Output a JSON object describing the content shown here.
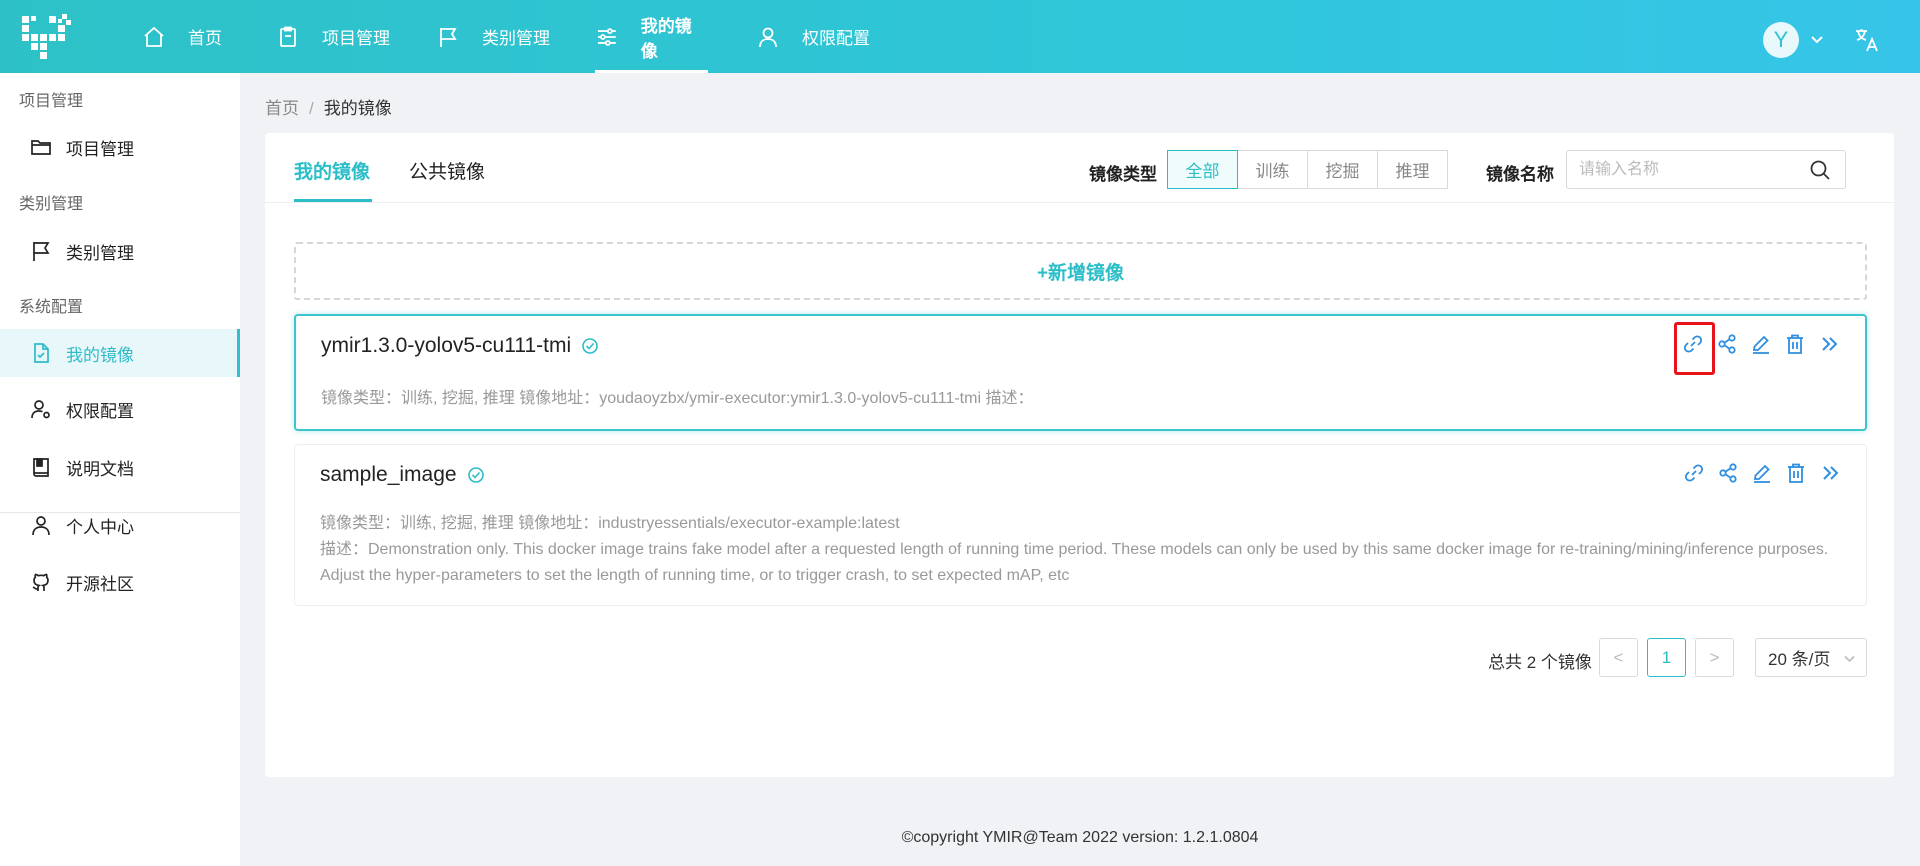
{
  "header": {
    "avatar_letter": "Y",
    "nav": [
      {
        "label": "首页",
        "icon": "home-icon"
      },
      {
        "label": "项目管理",
        "icon": "clipboard-icon"
      },
      {
        "label": "类别管理",
        "icon": "flag-icon"
      },
      {
        "label": "我的镜像",
        "icon": "sliders-icon"
      },
      {
        "label": "权限配置",
        "icon": "user-icon"
      }
    ]
  },
  "sidebar": {
    "groups": [
      "项目管理",
      "类别管理",
      "系统配置"
    ],
    "items": [
      {
        "label": "项目管理",
        "icon": "folder-icon"
      },
      {
        "label": "类别管理",
        "icon": "flag-icon"
      },
      {
        "label": "我的镜像",
        "icon": "file-icon"
      },
      {
        "label": "权限配置",
        "icon": "user-gear-icon"
      },
      {
        "label": "说明文档",
        "icon": "book-icon"
      },
      {
        "label": "个人中心",
        "icon": "user-icon"
      },
      {
        "label": "开源社区",
        "icon": "github-icon"
      }
    ]
  },
  "breadcrumb": {
    "home": "首页",
    "sep": "/",
    "current": "我的镜像"
  },
  "tabs": {
    "mine": "我的镜像",
    "public": "公共镜像"
  },
  "filter": {
    "type_label": "镜像类型",
    "types": [
      "全部",
      "训练",
      "挖掘",
      "推理"
    ],
    "name_label": "镜像名称",
    "search_placeholder": "请输入名称"
  },
  "add_button": "+新增镜像",
  "images": [
    {
      "name": "ymir1.3.0-yolov5-cu111-tmi",
      "meta": "镜像类型：训练, 挖掘, 推理  镜像地址：youdaoyzbx/ymir-executor:ymir1.3.0-yolov5-cu111-tmi  描述："
    },
    {
      "name": "sample_image",
      "meta": "镜像类型：训练, 挖掘, 推理  镜像地址：industryessentials/executor-example:latest",
      "desc": "描述：Demonstration only. This docker image trains fake model after a requested length of running time period. These models can only be used by this same docker image for re-training/mining/inference purposes. Adjust the hyper-parameters to set the length of running time, or to trigger crash, to set expected mAP, etc"
    }
  ],
  "pagination": {
    "total": "总共 2 个镜像",
    "prev": "<",
    "page": "1",
    "next": ">",
    "size": "20 条/页"
  },
  "footer": "©copyright YMIR@Team 2022 version: 1.2.1.0804",
  "colors": {
    "primary": "#2bbec8",
    "highlight_box": "#e8141b"
  }
}
